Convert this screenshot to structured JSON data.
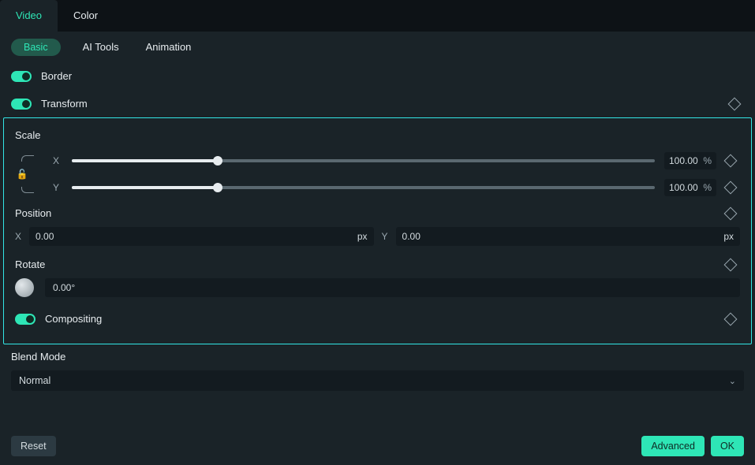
{
  "topTabs": {
    "video": "Video",
    "color": "Color"
  },
  "subNav": {
    "basic": "Basic",
    "aiTools": "AI Tools",
    "animation": "Animation"
  },
  "sections": {
    "border": "Border",
    "transform": "Transform",
    "compositing": "Compositing",
    "blendMode": "Blend Mode"
  },
  "scale": {
    "label": "Scale",
    "x": {
      "axis": "X",
      "value": "100.00",
      "unit": "%"
    },
    "y": {
      "axis": "Y",
      "value": "100.00",
      "unit": "%"
    }
  },
  "position": {
    "label": "Position",
    "x": {
      "axis": "X",
      "value": "0.00",
      "unit": "px"
    },
    "y": {
      "axis": "Y",
      "value": "0.00",
      "unit": "px"
    }
  },
  "rotate": {
    "label": "Rotate",
    "value": "0.00°"
  },
  "blendSelect": {
    "value": "Normal"
  },
  "footer": {
    "reset": "Reset",
    "advanced": "Advanced",
    "ok": "OK"
  }
}
